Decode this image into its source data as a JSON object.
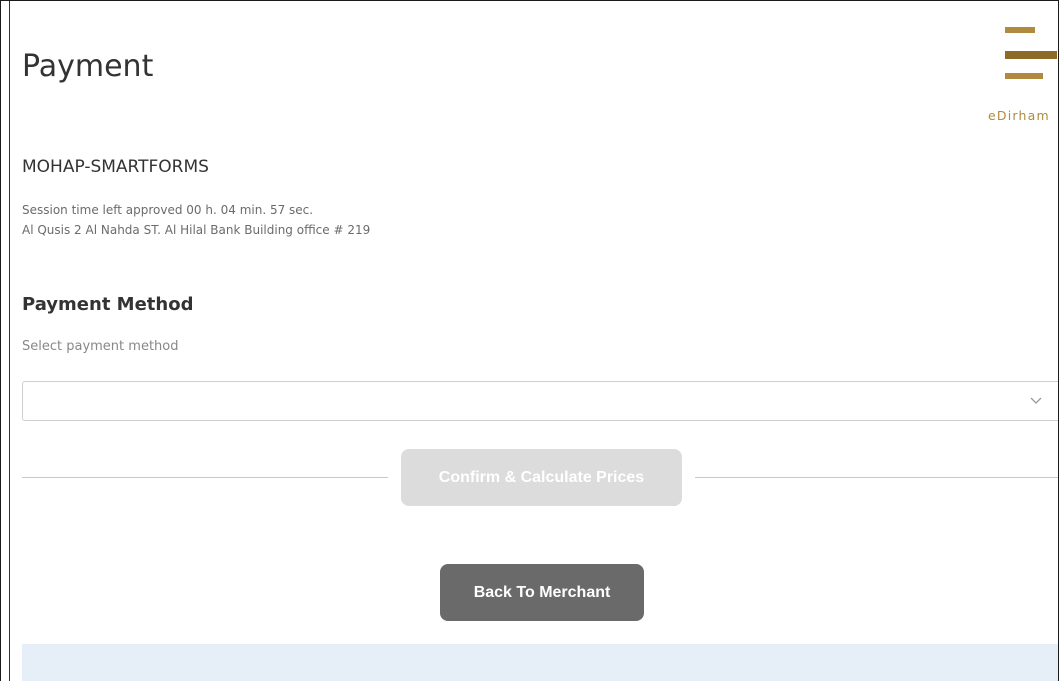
{
  "page": {
    "title": "Payment"
  },
  "logo": {
    "text": "eDirham",
    "icon": "edirham-logo-icon",
    "color": "#b08a3e"
  },
  "merchant": {
    "name": "MOHAP-SMARTFORMS",
    "session_line": "Session time left approved 00 h. 04 min. 57 sec.",
    "address_line": "Al Qusis 2 Al Nahda ST. Al Hilal Bank Building office # 219"
  },
  "payment_method": {
    "section_title": "Payment Method",
    "field_label": "Select payment method",
    "selected_value": "",
    "dropdown_icon": "chevron-down-icon"
  },
  "actions": {
    "confirm_label": "Confirm & Calculate Prices",
    "back_label": "Back To Merchant"
  },
  "colors": {
    "confirm_disabled": "#dcdcdc",
    "back_button": "#6a6a6a",
    "footer_band": "#e6eef7"
  }
}
